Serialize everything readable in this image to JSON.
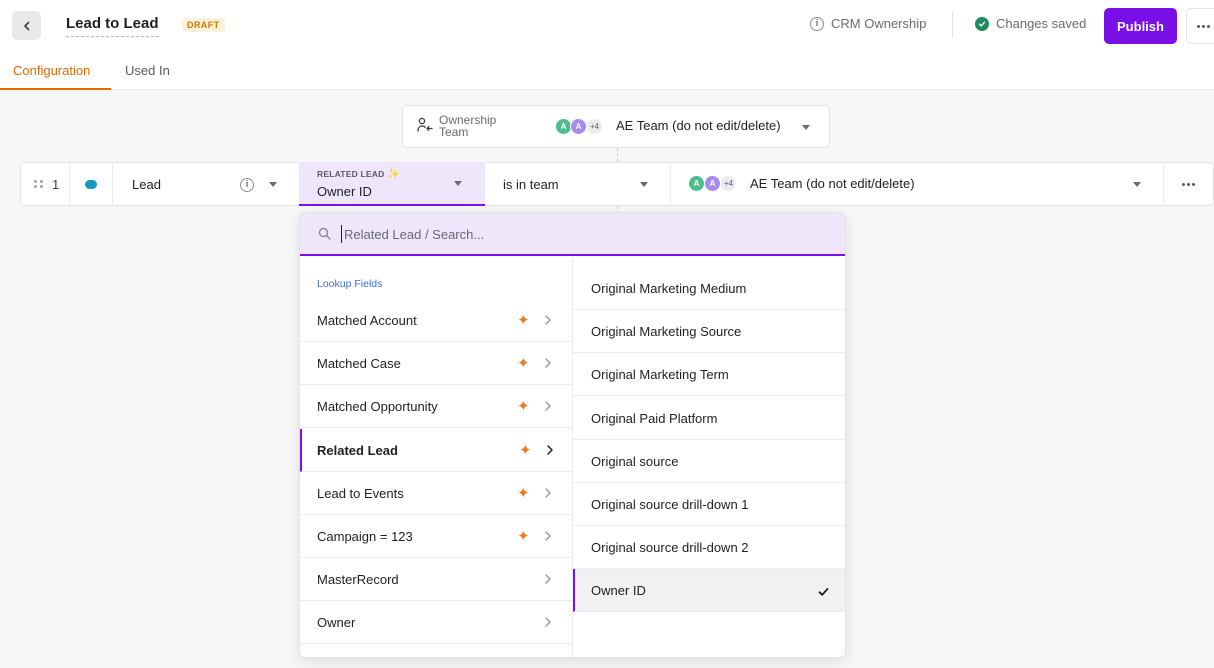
{
  "header": {
    "title": "Lead to Lead",
    "status_badge": "DRAFT",
    "crm_ownership_label": "CRM Ownership",
    "save_status": "Changes saved",
    "publish_label": "Publish"
  },
  "tabs": [
    {
      "label": "Configuration",
      "active": true
    },
    {
      "label": "Used In",
      "active": false
    }
  ],
  "ownership": {
    "label": "Ownership Team",
    "avatars": [
      "A",
      "A",
      "+4"
    ],
    "value": "AE Team (do not edit/delete)"
  },
  "rule_row": {
    "index": "1",
    "object": "Lead",
    "field_sublabel": "RELATED LEAD",
    "field_value": "Owner ID",
    "operator": "is in team",
    "avatars": [
      "A",
      "A",
      "+4"
    ],
    "team_value": "AE Team (do not edit/delete)"
  },
  "dropdown": {
    "search_placeholder": "Related Lead / Search...",
    "section_title": "Lookup Fields",
    "lookup_items": [
      {
        "label": "Matched Account",
        "sparkle": true,
        "active": false
      },
      {
        "label": "Matched Case",
        "sparkle": true,
        "active": false
      },
      {
        "label": "Matched Opportunity",
        "sparkle": true,
        "active": false
      },
      {
        "label": "Related Lead",
        "sparkle": true,
        "active": true
      },
      {
        "label": "Lead to Events",
        "sparkle": true,
        "active": false
      },
      {
        "label": "Campaign = 123",
        "sparkle": true,
        "active": false
      },
      {
        "label": "MasterRecord",
        "sparkle": false,
        "active": false
      },
      {
        "label": "Owner",
        "sparkle": false,
        "active": false
      }
    ],
    "fields": [
      {
        "label": "Original Marketing Medium",
        "selected": false
      },
      {
        "label": "Original Marketing Source",
        "selected": false
      },
      {
        "label": "Original Marketing Term",
        "selected": false
      },
      {
        "label": "Original Paid Platform",
        "selected": false
      },
      {
        "label": "Original source",
        "selected": false
      },
      {
        "label": "Original source drill-down 1",
        "selected": false
      },
      {
        "label": "Original source drill-down 2",
        "selected": false
      },
      {
        "label": "Owner ID",
        "selected": true
      }
    ]
  },
  "colors": {
    "accent": "#7a10e8",
    "tab_active": "#e06a00",
    "sparkle": "#f07b1d",
    "saved_check": "#1e8a5e"
  }
}
